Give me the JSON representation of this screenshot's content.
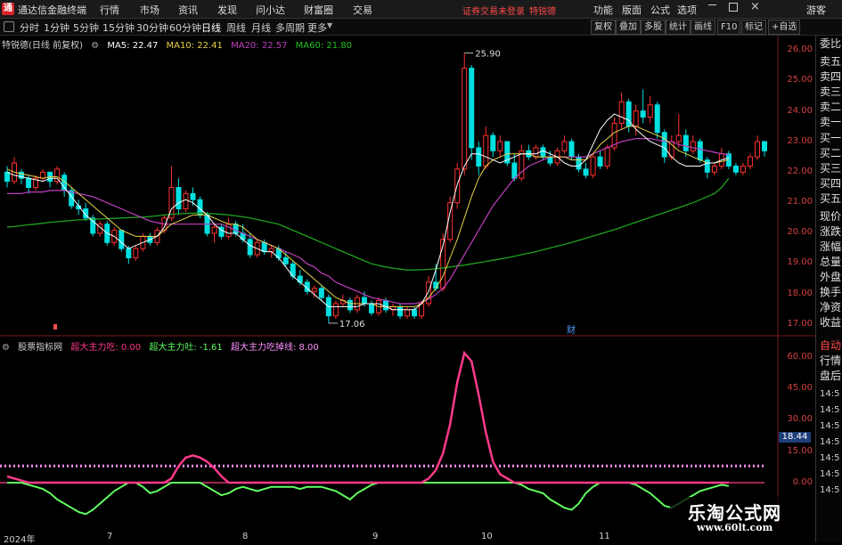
{
  "app": {
    "title": "通达信金融终端",
    "menus": [
      "行情",
      "市场",
      "资讯",
      "发现",
      "问小达",
      "财富圈",
      "交易"
    ],
    "notice": "证券交易未登录",
    "stock_name": "特锐德",
    "right_menus": [
      "功能",
      "版面",
      "公式",
      "选项"
    ],
    "guest": "游客"
  },
  "timeframes": [
    "分时",
    "1分钟",
    "5分钟",
    "15分钟",
    "30分钟",
    "60分钟",
    "日线",
    "周线",
    "月线",
    "多周期",
    "更多"
  ],
  "active_timeframe": "日线",
  "tools": [
    "复权",
    "叠加",
    "多股",
    "统计",
    "画线",
    "F10",
    "标记",
    "+自选"
  ],
  "main_legend": {
    "name": "特锐德(日线 前复权)",
    "ma5": "MA5: 22.47",
    "ma10": "MA10: 22.41",
    "ma20": "MA20: 22.57",
    "ma60": "MA60: 21.80"
  },
  "sub_legend": {
    "name": "股票指标网",
    "l1": "超大主力吃: 0.00",
    "l2": "超大主力吐: -1.61",
    "l3": "超大主力吃掉线: 8.00"
  },
  "y_labels": [
    "26.00",
    "25.00",
    "24.00",
    "23.00",
    "22.00",
    "21.00",
    "20.00",
    "19.00",
    "18.00",
    "17.00"
  ],
  "sub_y_labels": [
    "60.00",
    "45.00",
    "30.00",
    "15.00",
    "0.00"
  ],
  "sub_value_badge": "18.44",
  "annotations": {
    "high": "25.90",
    "low": "17.06",
    "marker": "财"
  },
  "x_labels": [
    "2024年",
    "7",
    "8",
    "9",
    "10",
    "11"
  ],
  "right_panel": [
    "委比",
    "卖五",
    "卖四",
    "卖三",
    "卖二",
    "卖一",
    "买一",
    "买二",
    "买三",
    "买四",
    "买五",
    "现价",
    "涨跌",
    "涨幅",
    "总量",
    "外盘",
    "换手",
    "净资",
    "收益",
    "自动",
    "行情",
    "盘后",
    "14:5",
    "14:5",
    "14:5",
    "14:5",
    "14:5",
    "14:5",
    "14:5"
  ],
  "watermark": {
    "title": "乐淘公式网",
    "url": "www.60lt.com"
  },
  "colors": {
    "up": "#ff3030",
    "down": "#00e0e0",
    "ma5": "#ffffff",
    "ma10": "#e8d24a",
    "ma20": "#c040c0",
    "ma60": "#20a020",
    "sub_eat": "#ff3a8a",
    "sub_spit": "#60ff60",
    "line8": "#ff90ff"
  },
  "chart_data": {
    "type": "candlestick",
    "ylim": [
      17,
      26
    ],
    "candles": [
      [
        22.0,
        22.2,
        21.5,
        21.7
      ],
      [
        21.7,
        22.5,
        21.6,
        22.3
      ],
      [
        22.0,
        22.1,
        21.6,
        21.8
      ],
      [
        21.8,
        21.9,
        21.3,
        21.5
      ],
      [
        21.5,
        21.9,
        21.4,
        21.8
      ],
      [
        21.8,
        22.1,
        21.7,
        22.0
      ],
      [
        22.0,
        22.0,
        21.5,
        21.7
      ],
      [
        21.7,
        22.2,
        21.6,
        22.1
      ],
      [
        21.9,
        22.0,
        21.2,
        21.4
      ],
      [
        21.4,
        21.5,
        20.8,
        20.9
      ],
      [
        20.9,
        21.1,
        20.6,
        20.8
      ],
      [
        20.8,
        21.0,
        20.4,
        20.5
      ],
      [
        20.5,
        20.6,
        19.9,
        20.0
      ],
      [
        20.0,
        20.4,
        19.9,
        20.3
      ],
      [
        20.3,
        20.4,
        19.6,
        19.7
      ],
      [
        19.7,
        20.2,
        19.6,
        20.1
      ],
      [
        20.1,
        20.1,
        19.4,
        19.5
      ],
      [
        19.5,
        19.6,
        19.0,
        19.2
      ],
      [
        19.2,
        19.6,
        19.1,
        19.5
      ],
      [
        19.5,
        20.0,
        19.4,
        19.9
      ],
      [
        19.9,
        20.0,
        19.6,
        19.7
      ],
      [
        19.7,
        20.2,
        19.6,
        20.1
      ],
      [
        20.1,
        20.6,
        20.0,
        20.5
      ],
      [
        20.5,
        22.2,
        20.4,
        21.5
      ],
      [
        21.5,
        21.8,
        20.6,
        20.8
      ],
      [
        20.8,
        21.4,
        20.7,
        21.3
      ],
      [
        21.3,
        21.5,
        20.9,
        21.1
      ],
      [
        21.1,
        21.2,
        20.5,
        20.6
      ],
      [
        20.6,
        20.7,
        19.9,
        20.0
      ],
      [
        20.0,
        20.3,
        19.7,
        20.2
      ],
      [
        20.2,
        20.3,
        19.8,
        19.9
      ],
      [
        19.9,
        20.5,
        19.8,
        20.3
      ],
      [
        20.3,
        20.4,
        19.9,
        20.0
      ],
      [
        20.0,
        20.3,
        19.7,
        19.8
      ],
      [
        19.8,
        20.0,
        19.2,
        19.3
      ],
      [
        19.3,
        19.8,
        19.2,
        19.7
      ],
      [
        19.7,
        19.8,
        19.3,
        19.4
      ],
      [
        19.4,
        19.6,
        19.2,
        19.5
      ],
      [
        19.5,
        19.6,
        19.1,
        19.2
      ],
      [
        19.2,
        19.4,
        18.9,
        19.0
      ],
      [
        19.0,
        19.1,
        18.5,
        18.6
      ],
      [
        18.6,
        18.8,
        18.3,
        18.4
      ],
      [
        18.4,
        18.5,
        18.0,
        18.1
      ],
      [
        18.1,
        18.3,
        17.9,
        18.2
      ],
      [
        18.2,
        18.3,
        17.8,
        17.9
      ],
      [
        17.9,
        18.0,
        17.06,
        17.3
      ],
      [
        17.3,
        17.8,
        17.2,
        17.7
      ],
      [
        17.7,
        18.0,
        17.6,
        17.8
      ],
      [
        17.8,
        17.9,
        17.4,
        17.5
      ],
      [
        17.5,
        18.0,
        17.4,
        17.9
      ],
      [
        17.9,
        18.1,
        17.6,
        17.7
      ],
      [
        17.7,
        17.8,
        17.3,
        17.4
      ],
      [
        17.4,
        17.9,
        17.3,
        17.8
      ],
      [
        17.8,
        17.9,
        17.4,
        17.5
      ],
      [
        17.5,
        17.7,
        17.3,
        17.6
      ],
      [
        17.6,
        17.7,
        17.2,
        17.3
      ],
      [
        17.3,
        17.6,
        17.2,
        17.5
      ],
      [
        17.5,
        17.6,
        17.2,
        17.3
      ],
      [
        17.3,
        17.8,
        17.2,
        17.7
      ],
      [
        17.7,
        18.6,
        17.6,
        18.4
      ],
      [
        18.4,
        19.0,
        18.1,
        18.2
      ],
      [
        18.2,
        20.0,
        18.1,
        19.8
      ],
      [
        19.8,
        21.2,
        19.7,
        21.0
      ],
      [
        21.0,
        22.3,
        20.8,
        22.1
      ],
      [
        22.1,
        25.9,
        21.9,
        25.4
      ],
      [
        25.4,
        25.5,
        22.4,
        22.8
      ],
      [
        22.8,
        23.0,
        21.9,
        22.2
      ],
      [
        22.2,
        23.5,
        22.1,
        23.2
      ],
      [
        23.2,
        23.3,
        22.5,
        22.7
      ],
      [
        22.7,
        23.2,
        22.5,
        23.0
      ],
      [
        23.0,
        23.0,
        22.2,
        22.3
      ],
      [
        22.3,
        22.6,
        21.7,
        21.8
      ],
      [
        21.8,
        22.9,
        21.7,
        22.7
      ],
      [
        22.7,
        22.9,
        22.4,
        22.5
      ],
      [
        22.5,
        22.9,
        22.4,
        22.8
      ],
      [
        22.8,
        22.9,
        22.4,
        22.5
      ],
      [
        22.5,
        22.7,
        22.2,
        22.3
      ],
      [
        22.3,
        22.8,
        22.2,
        22.7
      ],
      [
        22.7,
        23.2,
        22.6,
        23.0
      ],
      [
        23.0,
        23.1,
        22.4,
        22.5
      ],
      [
        22.5,
        22.6,
        22.0,
        22.1
      ],
      [
        22.1,
        22.3,
        21.8,
        21.9
      ],
      [
        21.9,
        22.6,
        21.8,
        22.5
      ],
      [
        22.5,
        22.7,
        22.1,
        22.2
      ],
      [
        22.2,
        22.9,
        22.1,
        22.8
      ],
      [
        22.8,
        23.8,
        22.7,
        23.6
      ],
      [
        23.6,
        24.6,
        23.4,
        24.3
      ],
      [
        24.3,
        24.4,
        23.3,
        23.5
      ],
      [
        23.5,
        24.2,
        23.2,
        24.0
      ],
      [
        24.0,
        24.7,
        23.6,
        23.8
      ],
      [
        23.8,
        24.5,
        23.6,
        24.2
      ],
      [
        24.2,
        24.3,
        23.1,
        23.3
      ],
      [
        23.3,
        23.4,
        22.3,
        22.5
      ],
      [
        22.5,
        23.2,
        22.4,
        23.0
      ],
      [
        23.0,
        23.9,
        22.8,
        23.2
      ],
      [
        23.2,
        23.4,
        22.5,
        22.7
      ],
      [
        22.7,
        23.2,
        22.6,
        23.0
      ],
      [
        23.0,
        23.1,
        22.3,
        22.4
      ],
      [
        22.4,
        22.5,
        21.8,
        22.0
      ],
      [
        22.0,
        22.3,
        21.9,
        22.2
      ],
      [
        22.2,
        22.8,
        22.1,
        22.6
      ],
      [
        22.6,
        22.7,
        22.1,
        22.2
      ],
      [
        22.2,
        22.3,
        21.9,
        22.0
      ],
      [
        22.0,
        22.3,
        21.9,
        22.2
      ],
      [
        22.2,
        22.6,
        22.1,
        22.5
      ],
      [
        22.5,
        23.2,
        22.4,
        23.0
      ],
      [
        23.0,
        23.0,
        22.5,
        22.7
      ]
    ],
    "ma5": [
      22.0,
      21.9,
      21.85,
      21.8,
      21.75,
      21.7,
      21.8,
      21.8,
      21.5,
      21.2,
      20.9,
      20.6,
      20.4,
      20.2,
      20.0,
      19.9,
      19.7,
      19.5,
      19.6,
      19.7,
      19.8,
      19.9,
      20.2,
      20.8,
      21.0,
      21.1,
      21.0,
      20.8,
      20.6,
      20.3,
      20.1,
      20.0,
      20.0,
      19.8,
      19.6,
      19.5,
      19.4,
      19.4,
      19.2,
      18.9,
      18.6,
      18.4,
      18.2,
      18.0,
      17.8,
      17.6,
      17.6,
      17.6,
      17.6,
      17.6,
      17.7,
      17.7,
      17.7,
      17.6,
      17.5,
      17.5,
      17.5,
      17.5,
      17.7,
      18.1,
      18.8,
      19.6,
      20.7,
      21.6,
      22.2,
      22.6,
      22.6,
      22.5,
      22.4,
      22.3,
      22.4,
      22.5,
      22.6,
      22.6,
      22.6,
      22.7,
      22.6,
      22.5,
      22.3,
      22.2,
      22.2,
      22.4,
      22.9,
      23.4,
      23.7,
      23.9,
      23.8,
      23.7,
      23.4,
      23.2,
      23.0,
      22.9,
      22.8,
      22.5,
      22.3,
      22.2,
      22.2,
      22.2,
      22.3,
      22.3,
      22.4,
      22.47
    ],
    "ma10": [
      22.1,
      22.0,
      21.95,
      21.9,
      21.85,
      21.8,
      21.85,
      21.85,
      21.7,
      21.5,
      21.3,
      21.1,
      20.9,
      20.7,
      20.5,
      20.3,
      20.1,
      20.0,
      19.9,
      19.9,
      19.9,
      19.9,
      20.1,
      20.3,
      20.4,
      20.5,
      20.6,
      20.6,
      20.6,
      20.5,
      20.4,
      20.3,
      20.3,
      20.2,
      20.0,
      19.8,
      19.7,
      19.6,
      19.5,
      19.3,
      19.1,
      18.9,
      18.7,
      18.5,
      18.3,
      18.1,
      17.9,
      17.8,
      17.7,
      17.7,
      17.7,
      17.7,
      17.6,
      17.6,
      17.6,
      17.6,
      17.6,
      17.6,
      17.7,
      17.9,
      18.2,
      18.6,
      19.2,
      19.8,
      20.5,
      21.2,
      21.8,
      22.2,
      22.4,
      22.5,
      22.6,
      22.6,
      22.6,
      22.6,
      22.5,
      22.5,
      22.5,
      22.5,
      22.5,
      22.4,
      22.4,
      22.4,
      22.6,
      22.9,
      23.1,
      23.3,
      23.4,
      23.5,
      23.5,
      23.4,
      23.3,
      23.2,
      23.1,
      22.9,
      22.7,
      22.6,
      22.5,
      22.4,
      22.3,
      22.3,
      22.35,
      22.41
    ],
    "ma20": [
      21.3,
      21.3,
      21.3,
      21.35,
      21.35,
      21.35,
      21.4,
      21.4,
      21.4,
      21.35,
      21.3,
      21.25,
      21.2,
      21.1,
      21.0,
      20.9,
      20.8,
      20.7,
      20.6,
      20.5,
      20.4,
      20.35,
      20.3,
      20.3,
      20.3,
      20.3,
      20.3,
      20.3,
      20.3,
      20.3,
      20.3,
      20.2,
      20.1,
      20.0,
      19.9,
      19.8,
      19.7,
      19.6,
      19.5,
      19.4,
      19.3,
      19.2,
      19.0,
      18.9,
      18.7,
      18.6,
      18.4,
      18.3,
      18.2,
      18.1,
      18.0,
      17.9,
      17.85,
      17.8,
      17.75,
      17.7,
      17.7,
      17.7,
      17.75,
      17.85,
      18.0,
      18.2,
      18.5,
      18.9,
      19.3,
      19.7,
      20.1,
      20.5,
      20.9,
      21.2,
      21.5,
      21.8,
      22.0,
      22.2,
      22.3,
      22.4,
      22.5,
      22.5,
      22.5,
      22.5,
      22.5,
      22.5,
      22.6,
      22.7,
      22.8,
      22.9,
      23.0,
      23.05,
      23.1,
      23.1,
      23.1,
      23.05,
      23.0,
      23.0,
      22.9,
      22.85,
      22.8,
      22.75,
      22.7,
      22.65,
      22.6,
      22.57
    ],
    "ma60": [
      20.2,
      20.22,
      20.25,
      20.28,
      20.3,
      20.33,
      20.36,
      20.38,
      20.4,
      20.42,
      20.44,
      20.45,
      20.46,
      20.47,
      20.48,
      20.49,
      20.5,
      20.51,
      20.52,
      20.53,
      20.55,
      20.57,
      20.6,
      20.62,
      20.64,
      20.65,
      20.66,
      20.66,
      20.65,
      20.64,
      20.62,
      20.6,
      20.57,
      20.54,
      20.5,
      20.45,
      20.4,
      20.35,
      20.3,
      20.2,
      20.1,
      20.0,
      19.9,
      19.8,
      19.7,
      19.6,
      19.5,
      19.4,
      19.3,
      19.2,
      19.1,
      19.0,
      18.95,
      18.9,
      18.86,
      18.83,
      18.8,
      18.8,
      18.81,
      18.82,
      18.84,
      18.87,
      18.9,
      18.93,
      18.96,
      19.0,
      19.04,
      19.08,
      19.12,
      19.16,
      19.2,
      19.25,
      19.3,
      19.35,
      19.4,
      19.46,
      19.52,
      19.58,
      19.64,
      19.7,
      19.77,
      19.84,
      19.91,
      19.98,
      20.05,
      20.12,
      20.2,
      20.28,
      20.36,
      20.44,
      20.52,
      20.6,
      20.68,
      20.76,
      20.84,
      20.92,
      21.0,
      21.1,
      21.2,
      21.3,
      21.5,
      21.8
    ],
    "sub": {
      "ylim": [
        -8,
        66
      ],
      "threshold": 8.0,
      "eat": [
        3,
        2,
        1,
        0,
        0,
        0,
        0,
        0,
        0,
        0,
        0,
        0,
        0,
        0,
        0,
        0,
        0,
        0,
        0,
        0,
        0,
        0,
        0,
        2,
        8,
        12,
        13,
        12,
        10,
        7,
        3,
        0,
        0,
        0,
        0,
        0,
        0,
        0,
        0,
        0,
        0,
        0,
        0,
        0,
        0,
        0,
        0,
        0,
        0,
        0,
        0,
        0,
        0,
        0,
        0,
        0,
        0,
        0,
        0,
        2,
        6,
        14,
        28,
        48,
        62,
        58,
        42,
        24,
        10,
        4,
        2,
        0,
        0,
        0,
        0,
        0,
        0,
        0,
        0,
        0,
        0,
        0,
        0,
        0,
        0,
        0,
        0,
        0,
        0,
        0,
        0,
        0,
        0,
        0,
        0,
        0,
        0,
        0,
        0,
        0,
        0,
        0
      ],
      "spit": [
        0,
        0,
        0,
        -1,
        -2,
        -3,
        -5,
        -8,
        -10,
        -12,
        -14,
        -15,
        -13,
        -10,
        -7,
        -4,
        -2,
        0,
        0,
        -2,
        -5,
        -4,
        -2,
        0,
        0,
        0,
        0,
        0,
        -2,
        -4,
        -6,
        -5,
        -3,
        -2,
        -3,
        -4,
        -3,
        -2,
        -2,
        -2,
        -2,
        -3,
        -2,
        -2,
        -2,
        -3,
        -4,
        -6,
        -8,
        -5,
        -3,
        -1,
        0,
        0,
        0,
        0,
        0,
        0,
        0,
        0,
        0,
        0,
        0,
        0,
        0,
        0,
        0,
        0,
        0,
        0,
        0,
        0,
        -1,
        -3,
        -4,
        -5,
        -8,
        -10,
        -12,
        -13,
        -10,
        -5,
        -2,
        0,
        0,
        0,
        0,
        0,
        -1,
        -3,
        -5,
        -8,
        -11,
        -12,
        -10,
        -8,
        -6,
        -4,
        -3,
        -2,
        -1,
        -1.61
      ]
    }
  }
}
